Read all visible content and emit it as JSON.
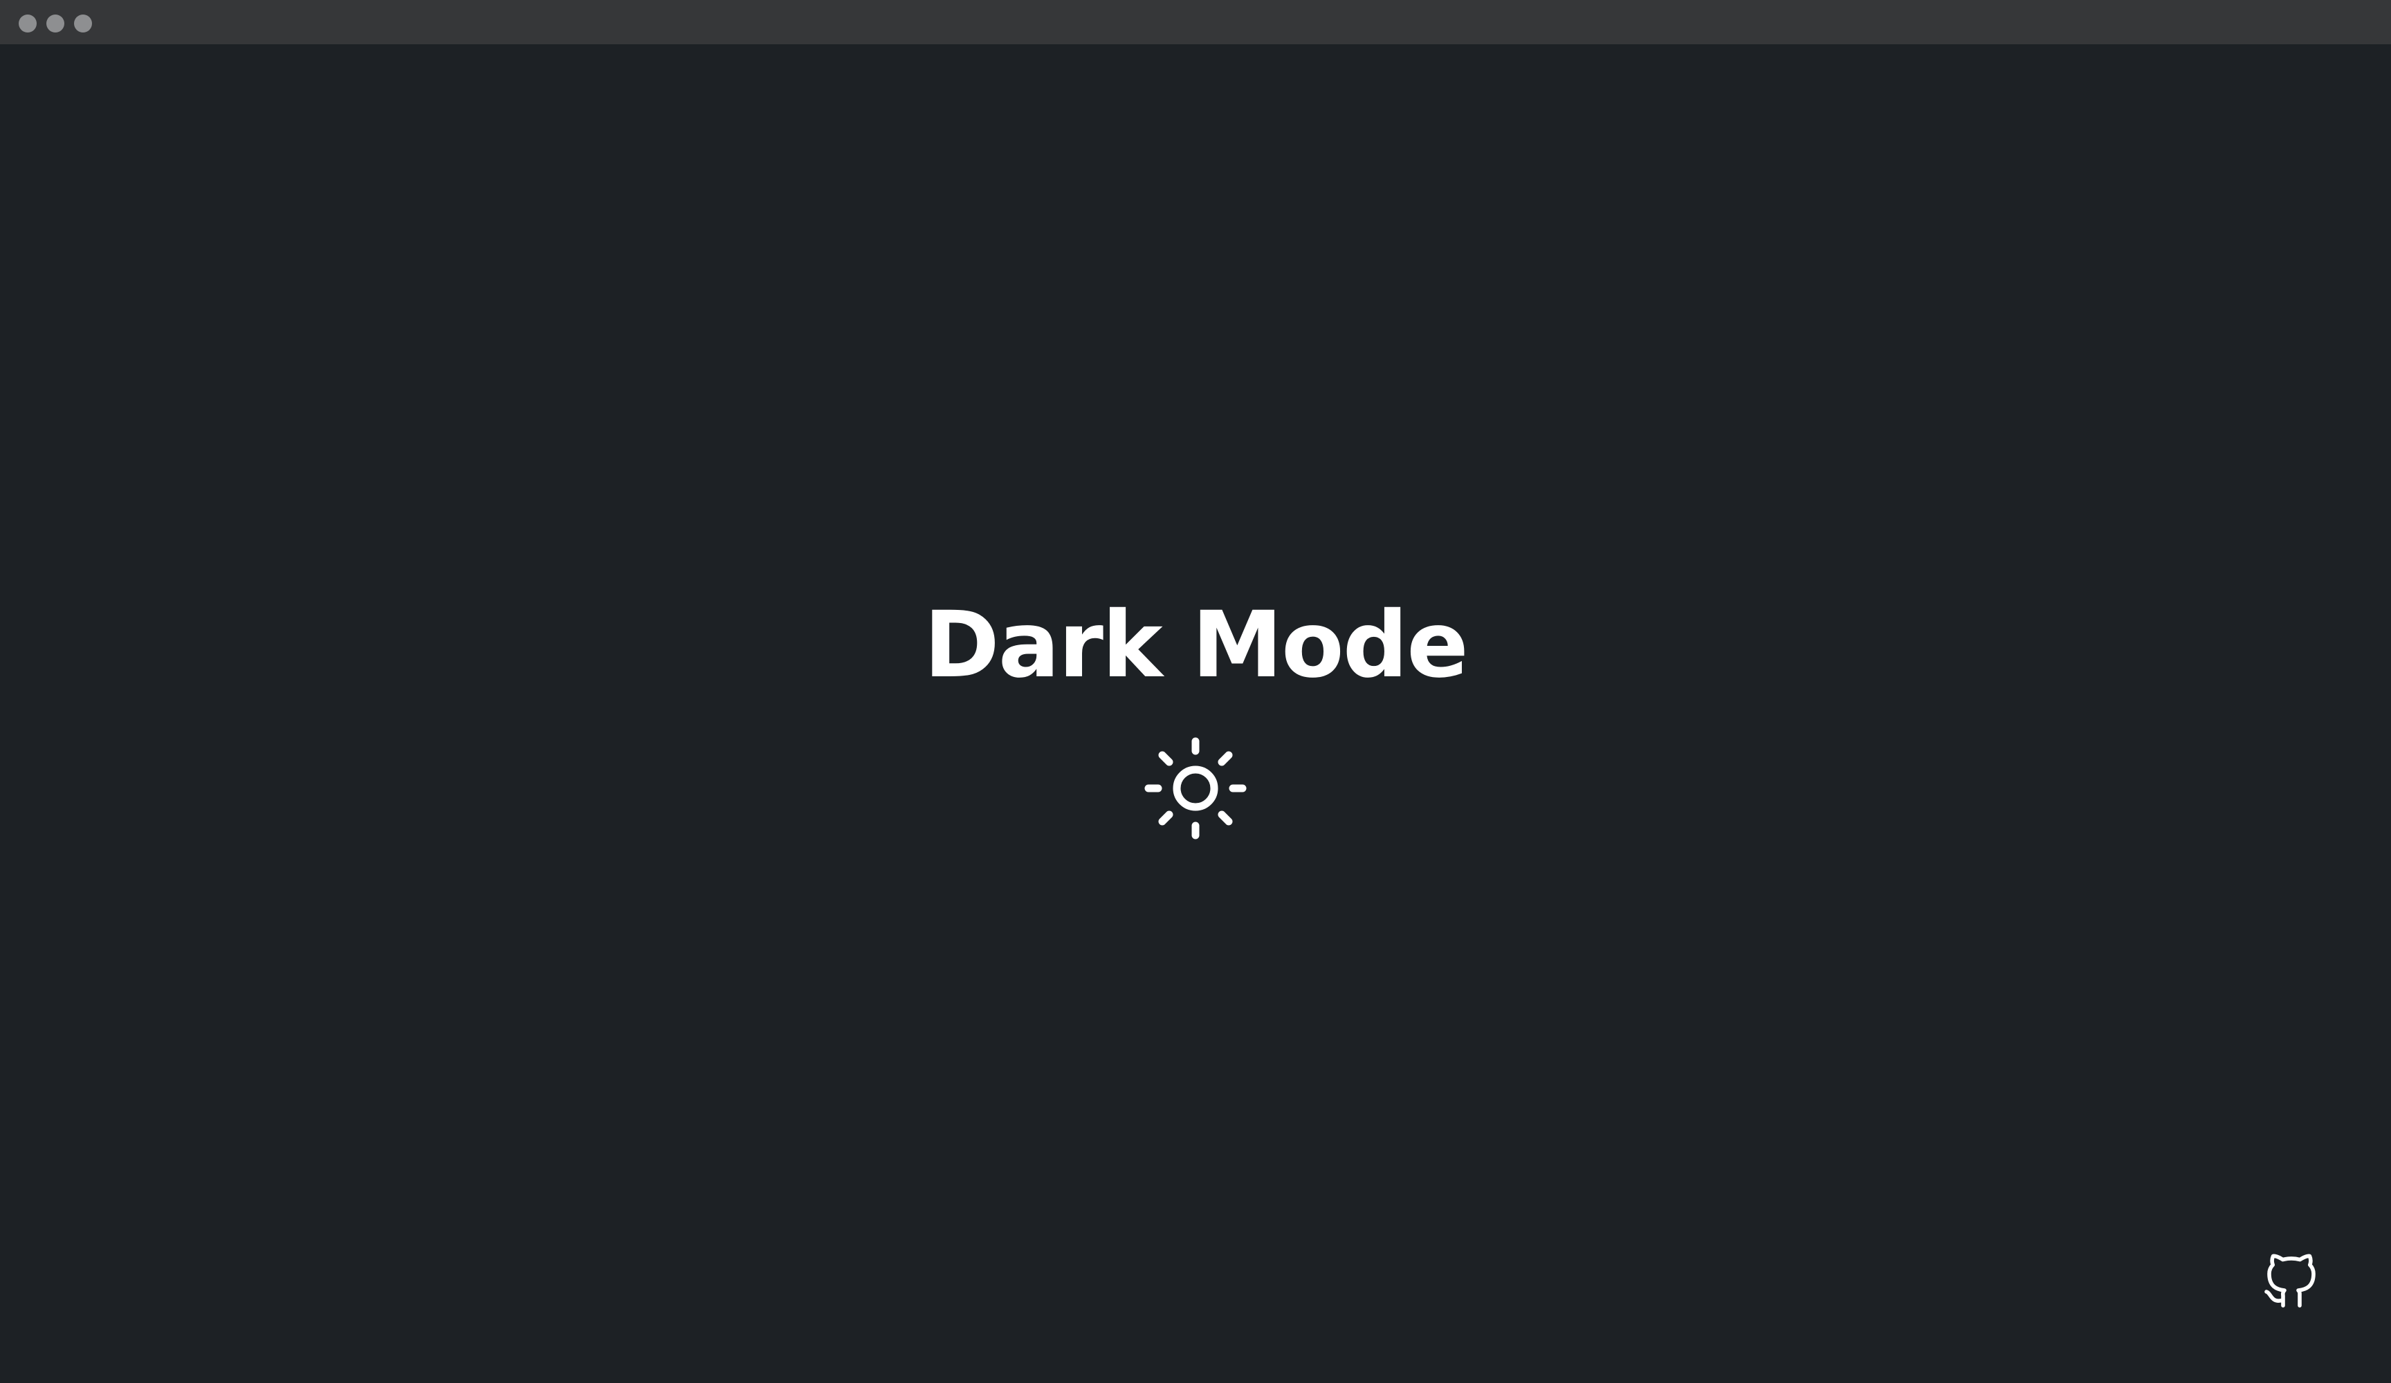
{
  "window": {
    "traffic_lights": [
      "close",
      "minimize",
      "zoom"
    ]
  },
  "main": {
    "title": "Dark Mode",
    "toggle_icon": "sun-icon"
  },
  "footer": {
    "link_icon": "github-icon"
  },
  "colors": {
    "background": "#1d2125",
    "titlebar": "#363739",
    "traffic_light": "#8e8f91",
    "text": "#ffffff"
  }
}
